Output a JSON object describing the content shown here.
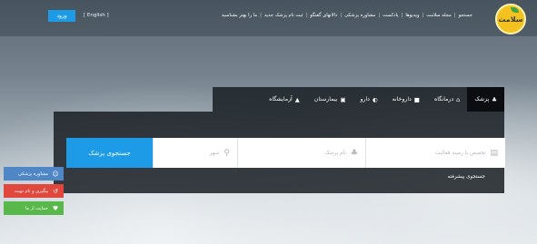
{
  "header": {
    "logo_text": "سلامت",
    "nav": [
      "جستجو",
      "مجله سلامت",
      "ویدیوها",
      "پادکست",
      "مشاوره پزشکی",
      "دالانهای گفتگو",
      "ثبت نام پزشک جدید",
      "ما را بهتر بشناسید"
    ],
    "language": "[ English ]",
    "login_label": "ورود"
  },
  "tabs": [
    {
      "icon": "♣",
      "label": "پزشک"
    },
    {
      "icon": "⌂",
      "label": "درمانگاه"
    },
    {
      "icon": "■",
      "label": "داروخانه"
    },
    {
      "icon": "◐",
      "label": "دارو"
    },
    {
      "icon": "▣",
      "label": "بیمارستان"
    },
    {
      "icon": "▲",
      "label": "آزمایشگاه"
    }
  ],
  "search": {
    "specialty_placeholder": "تخصص یا زمینه فعالیت",
    "name_placeholder": "نام پزشک",
    "city_placeholder": "شهر",
    "button_label": "جستجوی پزشک",
    "advanced_label": "جستجوی پیشرفته"
  },
  "side_buttons": [
    {
      "label": "مشاوره پزشکی",
      "icon": "☺"
    },
    {
      "label": "پیگیری و نام نوبت",
      "icon": "↺"
    },
    {
      "label": "حمایت از ما",
      "icon": "♥"
    }
  ],
  "colors": {
    "accent": "#1e9be6",
    "panel": "#191e23",
    "logo": "#f4c21e",
    "side_consult": "#4f86c6",
    "side_followup": "#e0483e",
    "side_support": "#58b94a"
  }
}
